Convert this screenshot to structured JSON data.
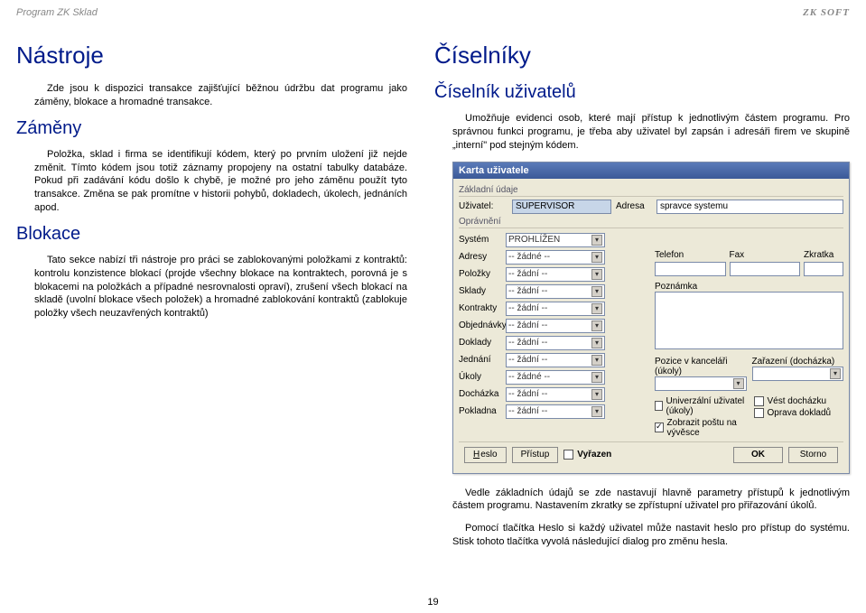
{
  "header": {
    "left": "Program ZK Sklad",
    "right": "ZK SOFT"
  },
  "left": {
    "h1": "Nástroje",
    "p1": "Zde jsou k dispozici transakce zajišťující běžnou údržbu dat programu jako záměny, blokace a hromadné transakce.",
    "h2a": "Záměny",
    "p2": "Položka, sklad i firma se identifikují kódem, který po prvním uložení již nejde změnit. Tímto kódem jsou totiž záznamy propojeny na ostatní tabulky databáze. Pokud při zadávání kódu došlo k chybě, je možné pro jeho záměnu použít tyto transakce. Změna se pak promítne v historii pohybů, dokladech, úkolech, jednáních apod.",
    "h2b": "Blokace",
    "p3": "Tato sekce nabízí tři nástroje pro práci se zablokovanými položkami z kontraktů: kontrolu konzistence blokací (projde všechny blokace na kontraktech, porovná je s blokacemi na položkách a případné nesrovnalosti opraví), zrušení všech blokací na skladě (uvolní blokace všech položek) a hromadné zablokování kontraktů (zablokuje položky všech neuzavřených kontraktů)"
  },
  "right": {
    "h1": "Číselníky",
    "h2": "Číselník uživatelů",
    "p1": "Umožňuje evidenci osob, které mají přístup k jednotlivým částem programu. Pro správnou funkci programu, je třeba aby uživatel byl zapsán i adresáři firem ve skupině „interní\" pod stejným kódem.",
    "p2": "Vedle základních údajů se zde nastavují hlavně parametry přístupů k jednotlivým částem programu. Nastavením zkratky se zpřístupní uživatel pro přiřazování úkolů.",
    "p3": "Pomocí tlačítka Heslo si každý uživatel může nastavit heslo pro přístup do systému. Stisk tohoto tlačítka vyvolá následující dialog pro změnu hesla."
  },
  "dlg": {
    "title": "Karta uživatele",
    "grp1": "Základní údaje",
    "uzivatel_lbl": "Uživatel:",
    "uzivatel_val": "SUPERVISOR",
    "adresa_lbl": "Adresa",
    "adresa_val": "spravce systemu",
    "grp2": "Oprávnění",
    "rows": {
      "system": {
        "lbl": "Systém",
        "val": "PROHLÍŽEN"
      },
      "adresy": {
        "lbl": "Adresy",
        "val": "-- žádné --"
      },
      "polozky": {
        "lbl": "Položky",
        "val": "-- žádní --"
      },
      "sklady": {
        "lbl": "Sklady",
        "val": "-- žádní --"
      },
      "kontrakty": {
        "lbl": "Kontrakty",
        "val": "-- žádní --"
      },
      "objednavky": {
        "lbl": "Objednávky",
        "val": "-- žádní --"
      },
      "doklady": {
        "lbl": "Doklady",
        "val": "-- žádní --"
      },
      "jednani": {
        "lbl": "Jednání",
        "val": "-- žádní --"
      },
      "ukoly": {
        "lbl": "Úkoly",
        "val": "-- žádné --"
      },
      "dochazka": {
        "lbl": "Docházka",
        "val": "-- žádní --"
      },
      "pokladna": {
        "lbl": "Pokladna",
        "val": "-- žádní --"
      }
    },
    "sub": {
      "telefon": "Telefon",
      "fax": "Fax",
      "zkratka": "Zkratka",
      "poznamka": "Poznámka",
      "pozice": "Pozice v kanceláři (úkoly)",
      "zarazeni": "Zařazení (docházka)",
      "chk1": "Univerzální uživatel (úkoly)",
      "chk2": "Vést docházku",
      "chk3": "Zobrazit poštu na vývěsce",
      "chk4": "Oprava dokladů"
    },
    "btns": {
      "heslo": "Heslo",
      "pristup": "Přístup",
      "vyrazen": "Vyřazen",
      "ok": "OK",
      "storno": "Storno"
    }
  },
  "pagenum": "19"
}
